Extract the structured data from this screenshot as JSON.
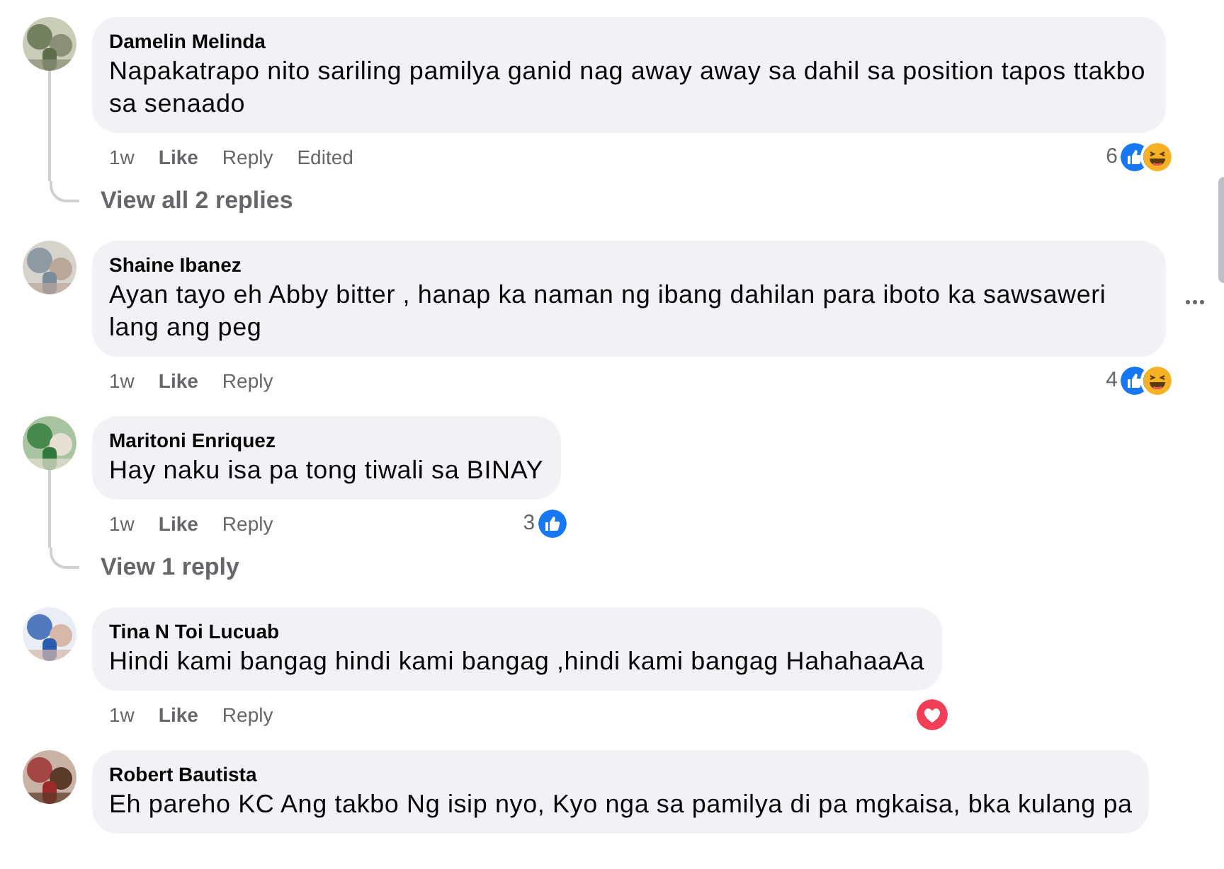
{
  "comments": [
    {
      "author": "Damelin Melinda",
      "text": "Napakatrapo nito sariling pamilya ganid nag away away sa dahil sa position tapos ttakbo sa senaado",
      "time": "1w",
      "like": "Like",
      "reply": "Reply",
      "edited": "Edited",
      "reactions": {
        "count": "6",
        "icons": [
          {
            "kind": "like"
          },
          {
            "kind": "haha"
          }
        ]
      },
      "replies_link": "View all 2 replies",
      "menu_visible": false
    },
    {
      "author": "Shaine Ibanez",
      "text": "Ayan tayo eh Abby bitter , hanap ka naman ng ibang dahilan para iboto ka sawsaweri lang ang peg",
      "time": "1w",
      "like": "Like",
      "reply": "Reply",
      "reactions": {
        "count": "4",
        "icons": [
          {
            "kind": "like"
          },
          {
            "kind": "haha"
          }
        ]
      },
      "menu_visible": true
    },
    {
      "author": "Maritoni Enriquez",
      "text": "Hay naku isa pa tong tiwali sa BINAY",
      "time": "1w",
      "like": "Like",
      "reply": "Reply",
      "reactions": {
        "count": "3",
        "icons": [
          {
            "kind": "like"
          }
        ]
      },
      "replies_link": "View 1 reply",
      "menu_visible": false
    },
    {
      "author": "Tina N Toi Lucuab",
      "text": "Hindi kami bangag hindi kami bangag ,hindi kami bangag HahahaaAa",
      "time": "1w",
      "like": "Like",
      "reply": "Reply",
      "reactions": {
        "icons": [
          {
            "kind": "love"
          }
        ]
      },
      "menu_visible": false
    },
    {
      "author": "Robert Bautista",
      "text": "Eh pareho KC Ang takbo Ng isip nyo, Kyo nga sa pamilya di pa mgkaisa, bka kulang pa",
      "menu_visible": false
    }
  ]
}
